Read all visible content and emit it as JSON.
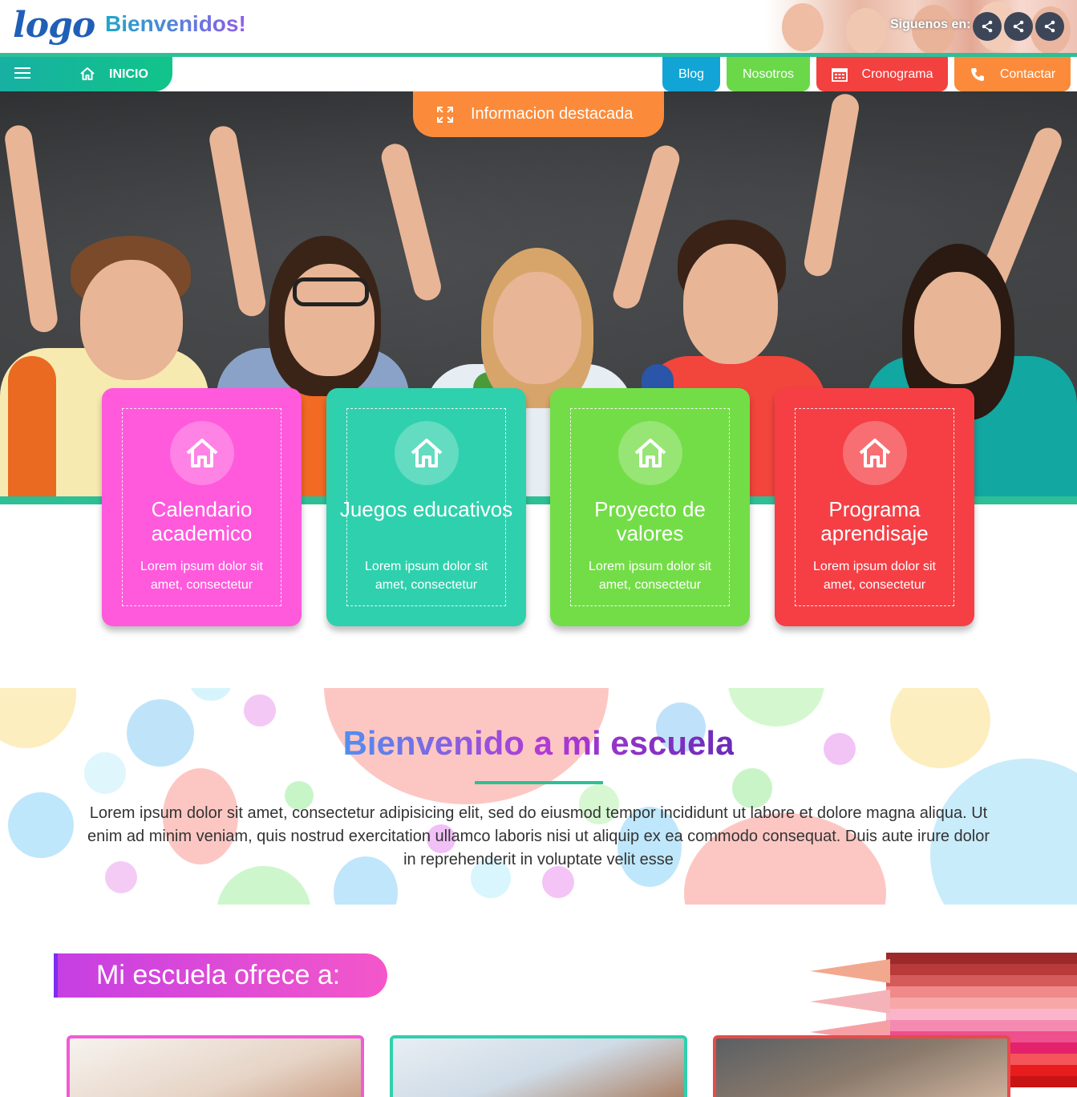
{
  "header": {
    "logo_text": "logo",
    "welcome": "Bienvenidos!",
    "social_label": "Siguenos en:",
    "social_icons": [
      "share-icon",
      "share-icon",
      "share-icon"
    ]
  },
  "nav": {
    "home_label": "INICIO",
    "tabs": [
      {
        "label": "Blog",
        "color": "#13a4d6"
      },
      {
        "label": "Nosotros",
        "color": "#6bd84a"
      },
      {
        "label": "Cronograma",
        "color": "#f2413f",
        "icon": "calendar-icon"
      },
      {
        "label": "Contactar",
        "color": "#fb8b3a",
        "icon": "phone-icon"
      }
    ]
  },
  "hero": {
    "featured_label": "Informacion destacada"
  },
  "cards": [
    {
      "title": "Calendario academico",
      "desc": "Lorem ipsum dolor sit amet, consectetur",
      "color": "#ff59dc",
      "icon": "home-icon"
    },
    {
      "title": "Juegos educativos",
      "desc": "Lorem ipsum dolor sit amet, consectetur",
      "color": "#2fd0ad",
      "icon": "home-icon"
    },
    {
      "title": "Proyecto de valores",
      "desc": "Lorem ipsum dolor sit amet, consectetur",
      "color": "#73dd47",
      "icon": "home-icon"
    },
    {
      "title": "Programa aprendisaje",
      "desc": "Lorem ipsum dolor sit amet, consectetur",
      "color": "#f53f45",
      "icon": "home-icon"
    }
  ],
  "welcome_section": {
    "title": "Bienvenido a mi escuela",
    "text": "Lorem ipsum dolor sit amet, consectetur adipisicing elit, sed do eiusmod tempor incididunt ut labore et dolore magna aliqua. Ut enim ad minim veniam, quis nostrud exercitation ullamco laboris nisi ut aliquip ex ea commodo consequat. Duis aute irure dolor in reprehenderit in voluptate velit esse"
  },
  "offer": {
    "title": "Mi escuela ofrece a:",
    "photo_borders": [
      "#f25ad6",
      "#2fd0ad",
      "#e84a4a"
    ]
  }
}
